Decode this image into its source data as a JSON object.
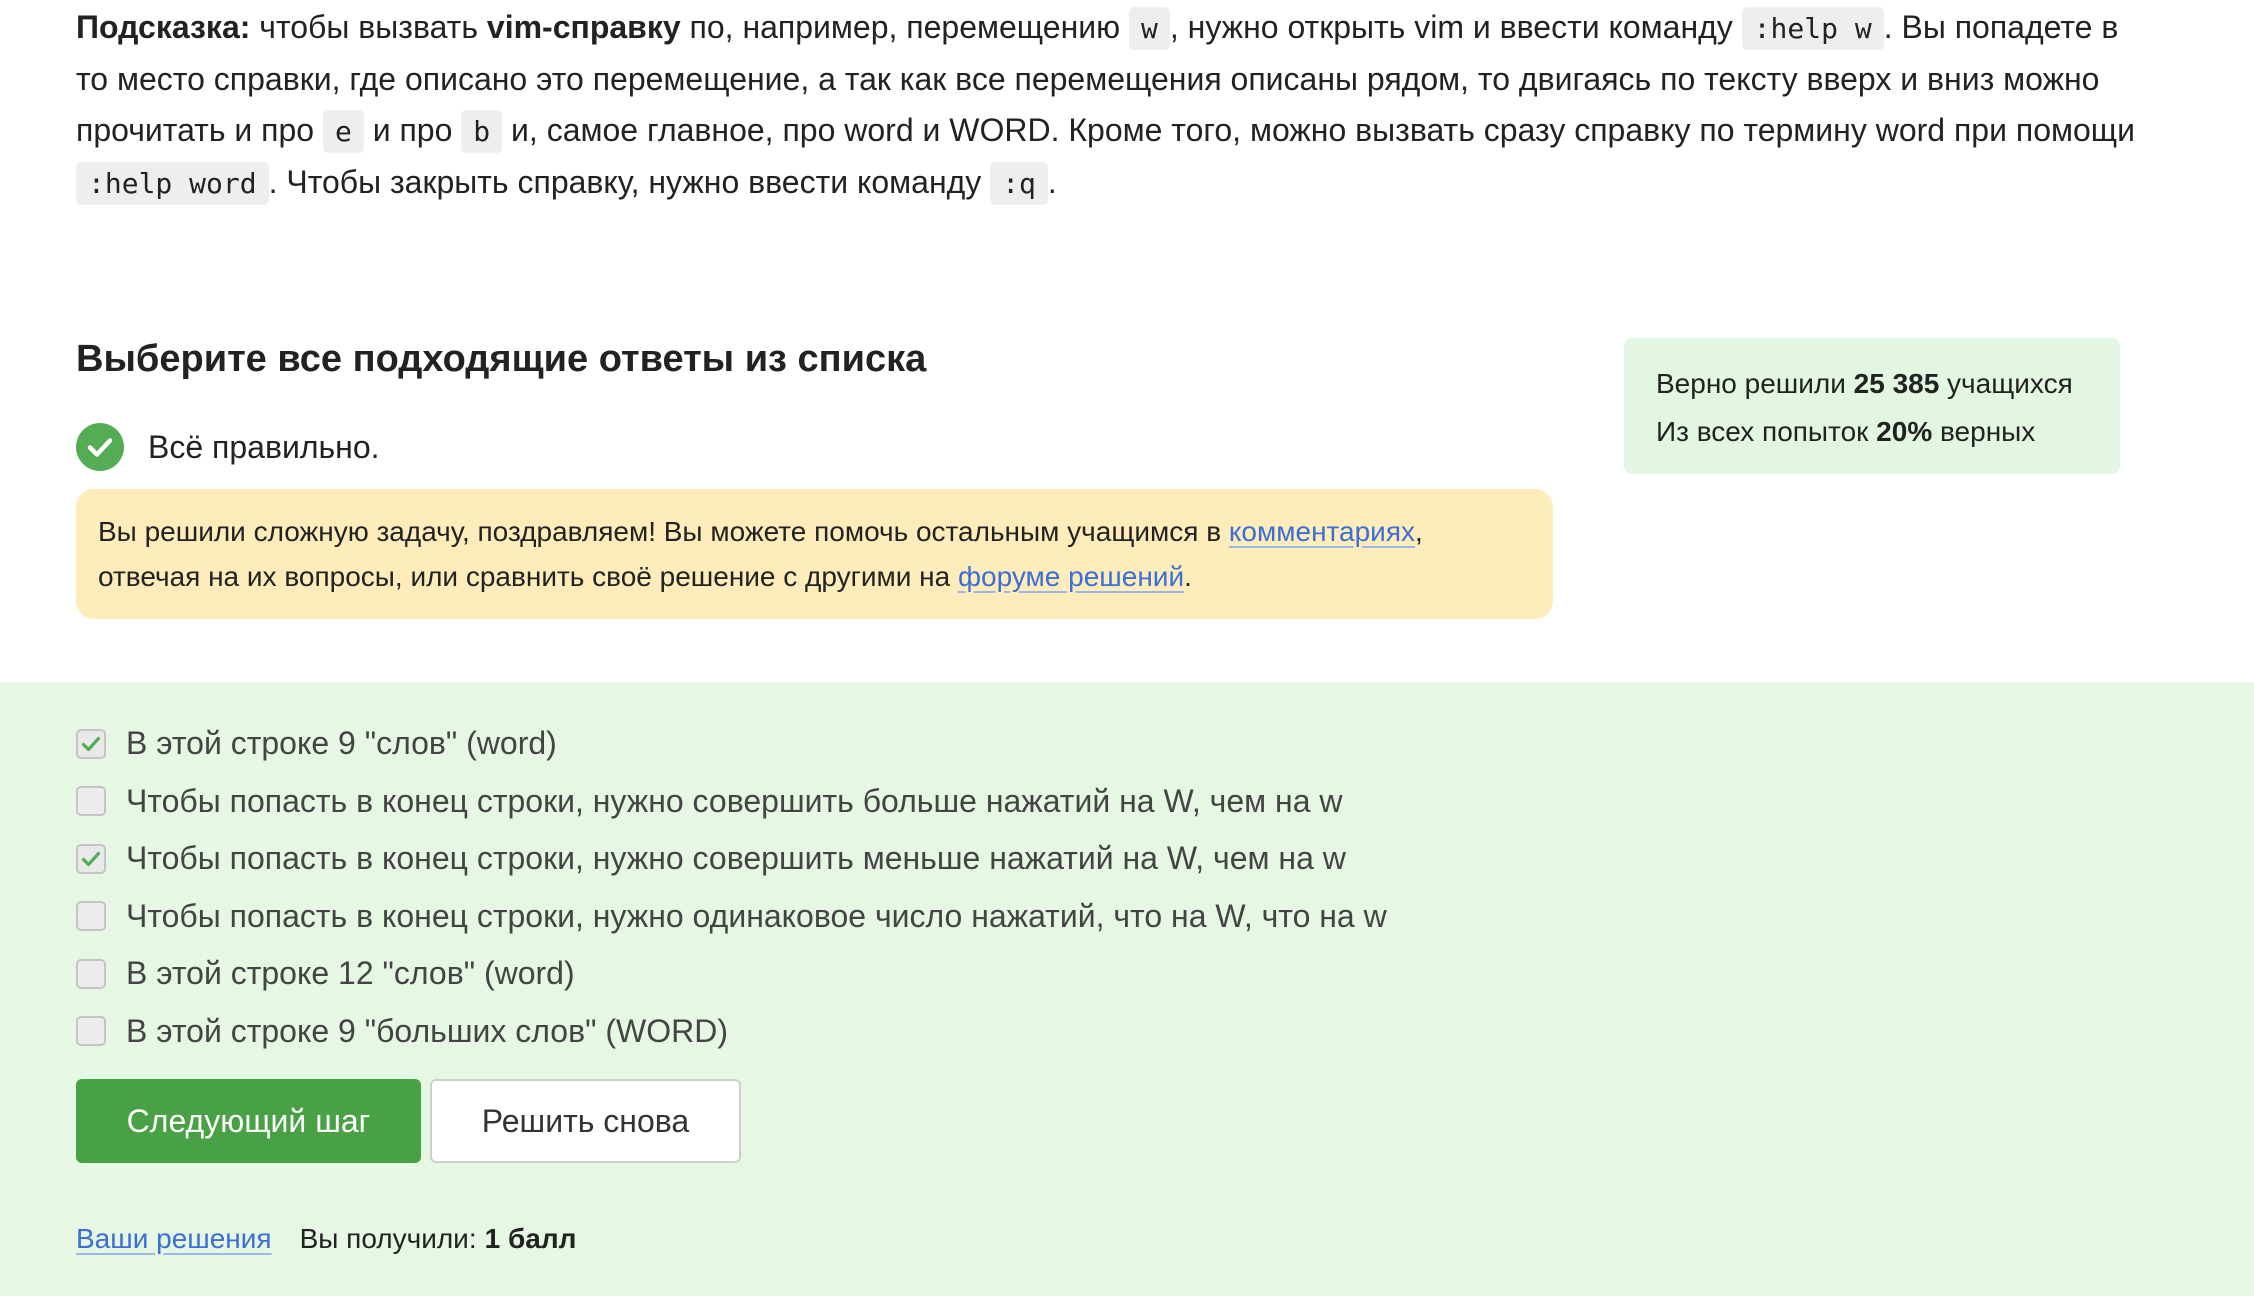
{
  "hint": {
    "label": "Подсказка:",
    "t1": " чтобы вызвать ",
    "vim_help": "vim-справку",
    "t2": " по, например, перемещению ",
    "code_w": "w",
    "t3": ", нужно открыть vim и ввести команду ",
    "code_help_w": ":help w",
    "t4": ". Вы попадете в то место справки, где описано это перемещение, а так как все перемещения описаны рядом, то двигаясь по тексту вверх и вниз можно прочитать и про ",
    "code_e": "e",
    "t5": " и про ",
    "code_b": "b",
    "t6": " и, самое главное, про word и WORD. Кроме того, можно вызвать сразу справку по термину word при помощи ",
    "code_help_word": ":help word",
    "t7": ". Чтобы закрыть справку, нужно ввести команду ",
    "code_q": ":q",
    "t8": "."
  },
  "question": {
    "title": "Выберите все подходящие ответы из списка",
    "status": "Всё правильно."
  },
  "congrats": {
    "t1": "Вы решили сложную задачу, поздравляем! Вы можете помочь остальным учащимся в ",
    "comments_link": "комментариях",
    "t2": ", отвечая на их вопросы, или сравнить своё решение с другими на ",
    "forum_link": "форуме решений",
    "t3": "."
  },
  "stats": {
    "solved_prefix": "Верно решили ",
    "solved_count": "25 385",
    "solved_suffix": " учащихся",
    "attempts_prefix": "Из всех попыток ",
    "attempts_percent": "20%",
    "attempts_suffix": " верных"
  },
  "options": [
    {
      "label": "В этой строке 9 \"слов\" (word)",
      "checked": true
    },
    {
      "label": "Чтобы попасть в конец строки, нужно совершить больше нажатий на W, чем на w",
      "checked": false
    },
    {
      "label": "Чтобы попасть в конец строки, нужно совершить меньше нажатий на W, чем на w",
      "checked": true
    },
    {
      "label": "Чтобы попасть в конец строки, нужно одинаковое число нажатий, что на W, что на w",
      "checked": false
    },
    {
      "label": "В этой строке 12 \"слов\" (word)",
      "checked": false
    },
    {
      "label": "В этой строке 9 \"больших слов\" (WORD)",
      "checked": false
    }
  ],
  "buttons": {
    "next": "Следующий шаг",
    "retry": "Решить снова"
  },
  "footer": {
    "solutions_link": "Ваши решения",
    "score_label": "Вы получили:",
    "score_value": "1 балл"
  },
  "colors": {
    "success_green": "#54ad54",
    "button_green": "#48a144",
    "answer_bg": "#e6f7e4",
    "notice_bg": "#ffecbb",
    "link_blue": "#3b6fd6"
  }
}
